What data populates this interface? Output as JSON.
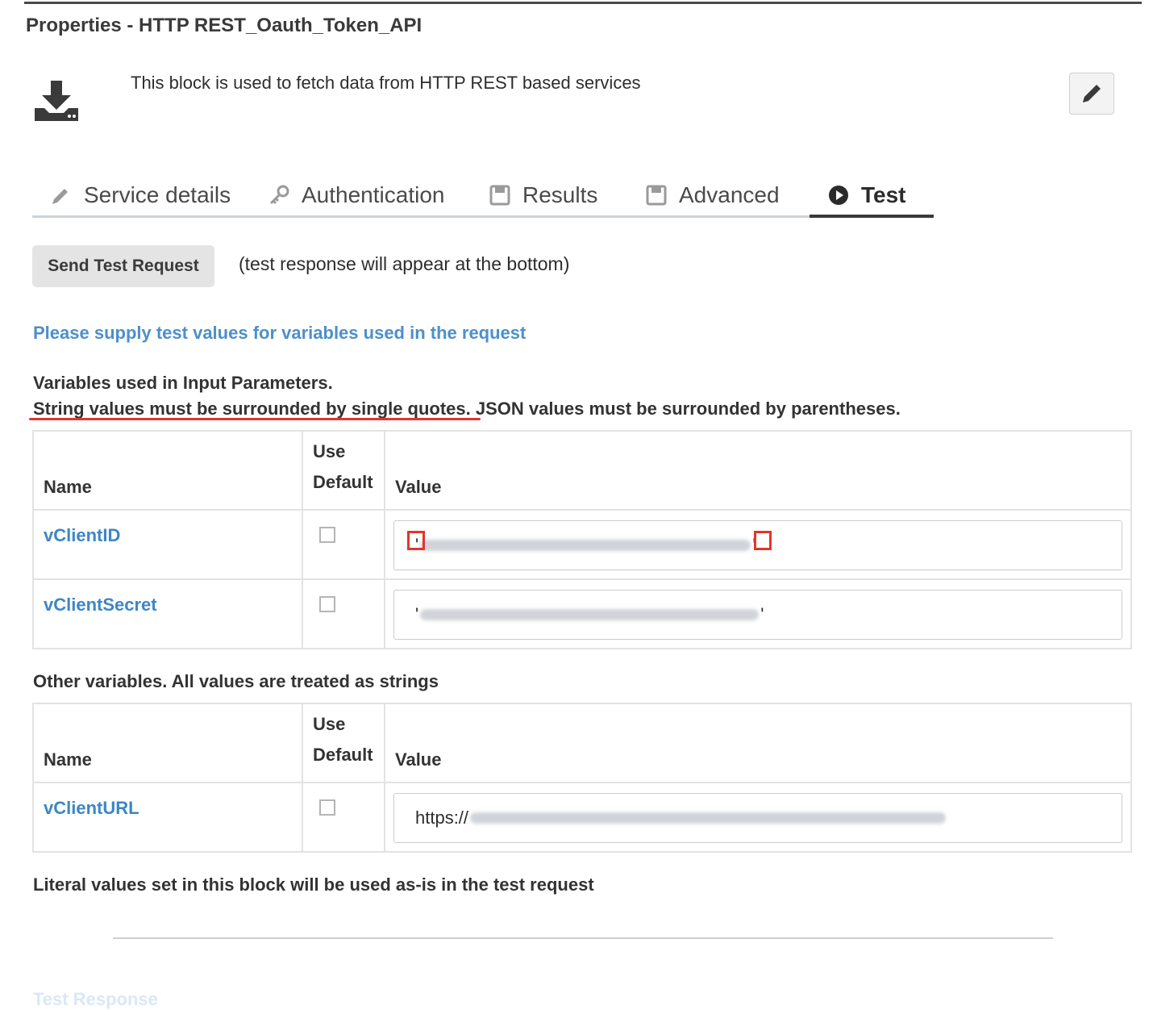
{
  "header": {
    "title": "Properties - HTTP REST_Oauth_Token_API",
    "description": "This block is used to fetch data from HTTP REST based services",
    "block_icon": "download-icon",
    "edit_icon": "pencil-icon"
  },
  "tabs": [
    {
      "label": "Service details",
      "icon": "pencil-icon",
      "active": false
    },
    {
      "label": "Authentication",
      "icon": "key-icon",
      "active": false
    },
    {
      "label": "Results",
      "icon": "save-icon",
      "active": false
    },
    {
      "label": "Advanced",
      "icon": "save-icon",
      "active": false
    },
    {
      "label": "Test",
      "icon": "play-circle-icon",
      "active": true
    }
  ],
  "test": {
    "send_label": "Send Test Request",
    "send_note": "(test response will appear at the bottom)",
    "supply_heading": "Please supply test values for variables used in the request",
    "input_params_label": "Variables used in Input Parameters.",
    "string_rule": "String values must be surrounded by single quotes.",
    "json_rule": " JSON values must be surrounded by parentheses.",
    "columns": {
      "name": "Name",
      "use_default_1": "Use",
      "use_default_2": "Default",
      "value": "Value"
    },
    "input_variables": [
      {
        "name": "vClientID",
        "use_default": false,
        "value_prefix": "'",
        "value_suffix": "'"
      },
      {
        "name": "vClientSecret",
        "use_default": false,
        "value_prefix": "'",
        "value_suffix": "'"
      }
    ],
    "other_label": "Other variables. All values are treated as strings",
    "other_variables": [
      {
        "name": "vClientURL",
        "use_default": false,
        "value_prefix": "https://"
      }
    ],
    "literal_note": "Literal values set in this block will be used as-is in the test request",
    "test_response_label": "Test Response"
  },
  "colors": {
    "accent_blue": "#4d8fcc",
    "link_blue": "#3d86c6",
    "annotation_red": "#e3352a"
  }
}
